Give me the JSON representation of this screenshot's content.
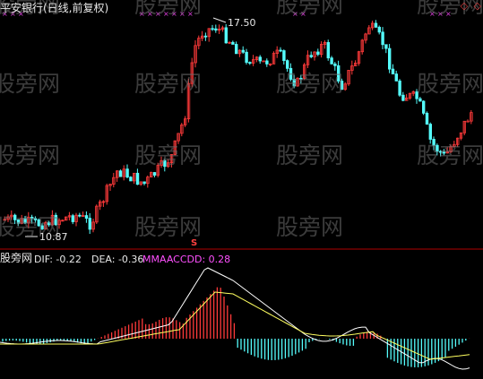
{
  "header": {
    "title": "平安银行(日线,前复权)"
  },
  "window_controls": [
    "◇",
    "◇"
  ],
  "price_panel": {
    "high_label": "17.50",
    "low_label": "10.87",
    "marker_glyph": "S"
  },
  "macd_panel": {
    "name": "股旁网",
    "dif_label": "DIF: -0.22",
    "dea_label": "DEA: -0.36",
    "mmaac_label": "MMAACCDD: 0.28"
  },
  "watermarks": [
    "股旁网",
    "股旁网",
    "股旁网",
    "股旁网",
    "股旁网",
    "股旁网",
    "股旁网",
    "股旁网",
    "股旁网",
    "股旁网",
    "股旁网",
    "股旁网",
    "股旁网",
    "股旁网",
    "股旁网"
  ],
  "colors": {
    "up": "#ff3a3a",
    "down": "#54fcfc",
    "dif": "#ffffff",
    "dea": "#ffff60",
    "mmaac": "#ff50ff",
    "separator": "#b00000",
    "x_markers": "#e040e0"
  }
}
